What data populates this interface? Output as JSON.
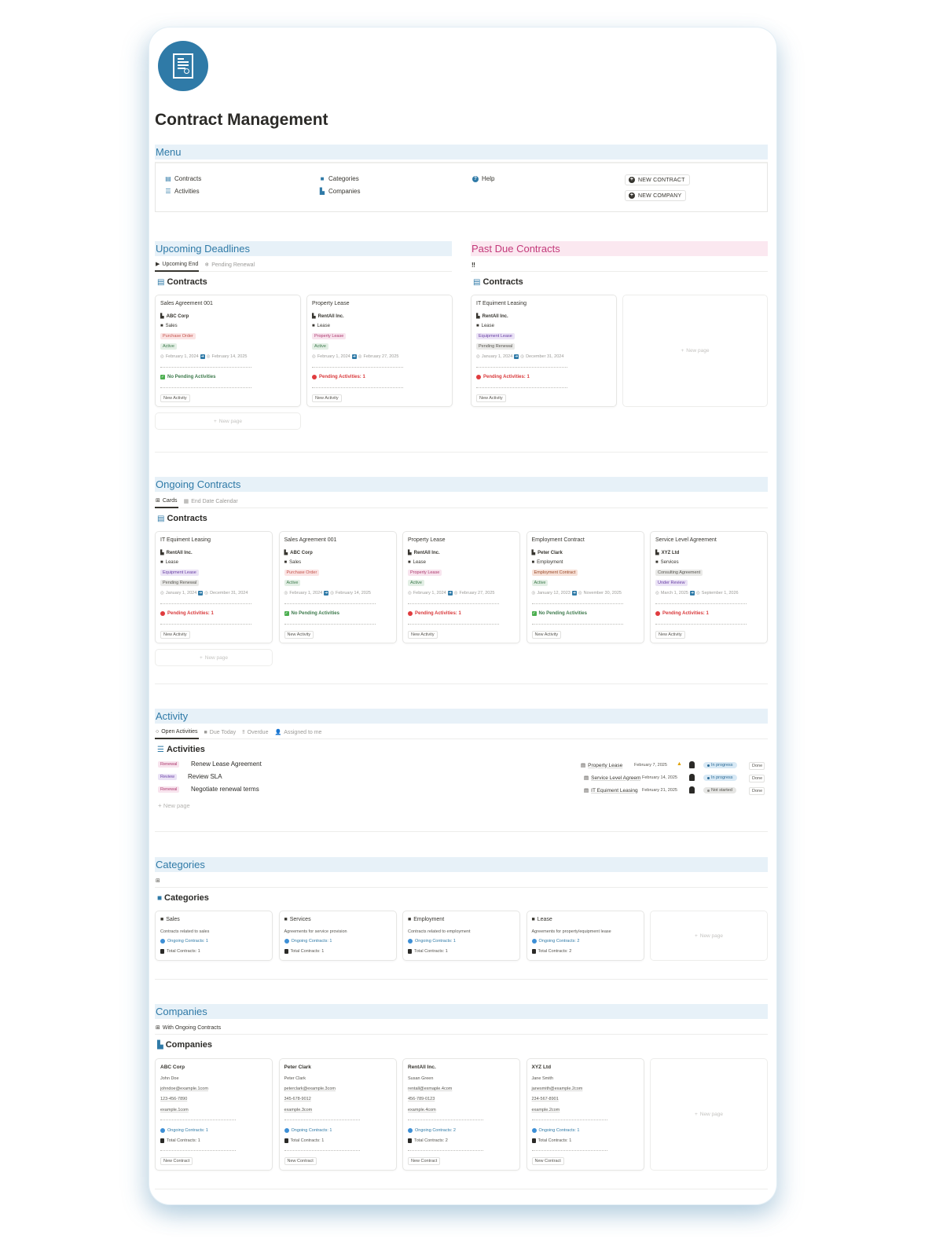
{
  "page": {
    "title": "Contract Management",
    "icon": "contract-certificate-icon"
  },
  "menu": {
    "header": "Menu",
    "links": [
      {
        "label": "Contracts",
        "icon": "contract-icon"
      },
      {
        "label": "Activities",
        "icon": "checklist-icon"
      },
      {
        "label": "Categories",
        "icon": "folder-icon"
      },
      {
        "label": "Companies",
        "icon": "buildings-icon"
      },
      {
        "label": "Help",
        "icon": "help-circle-icon"
      }
    ],
    "buttons": [
      {
        "label": "NEW CONTRACT",
        "icon": "plus-circle-icon"
      },
      {
        "label": "NEW COMPANY",
        "icon": "plus-circle-icon"
      }
    ]
  },
  "upcoming": {
    "header": "Upcoming Deadlines",
    "tabs": [
      {
        "label": "Upcoming End",
        "icon": "flag-icon",
        "active": true
      },
      {
        "label": "Pending Renewal",
        "icon": "snowflake-gear-icon",
        "active": false
      }
    ],
    "db_title": "Contracts",
    "cards": [
      {
        "name": "Sales Agreement 001",
        "company": "ABC Corp",
        "category": "Sales",
        "type": "Purchase Order",
        "status": "Active",
        "start": "February 1, 2024",
        "end": "February 14, 2025",
        "activities": "No Pending Activities",
        "button": "New Activity"
      },
      {
        "name": "Property Lease",
        "company": "RentAll Inc.",
        "category": "Lease",
        "type": "Property Lease",
        "status": "Active",
        "start": "February 1, 2024",
        "end": "February 27, 2025",
        "activities": "Pending Activities: 1",
        "button": "New Activity"
      }
    ],
    "new_page": "New page"
  },
  "past_due": {
    "header": "Past Due Contracts",
    "tab_icon": "double-exclamation-icon",
    "tab_label": "‼",
    "db_title": "Contracts",
    "cards": [
      {
        "name": "IT Equiment Leasing",
        "company": "RentAll Inc.",
        "category": "Lease",
        "type": "Equipment Lease",
        "status": "Pending Renewal",
        "start": "January 1, 2024",
        "end": "December 31, 2024",
        "activities": "Pending Activities: 1",
        "button": "New Activity"
      }
    ],
    "new_page": "New page"
  },
  "ongoing": {
    "header": "Ongoing Contracts",
    "tabs": [
      {
        "label": "Cards",
        "icon": "grid-icon",
        "active": true
      },
      {
        "label": "End Date Calendar",
        "icon": "calendar-icon",
        "active": false
      }
    ],
    "db_title": "Contracts",
    "cards": [
      {
        "name": "IT Equiment Leasing",
        "company": "RentAll Inc.",
        "category": "Lease",
        "type": "Equipment Lease",
        "status": "Pending Renewal",
        "start": "January 1, 2024",
        "end": "December 31, 2024",
        "activities": "Pending Activities: 1",
        "button": "New Activity"
      },
      {
        "name": "Sales Agreement 001",
        "company": "ABC Corp",
        "category": "Sales",
        "type": "Purchase Order",
        "status": "Active",
        "start": "February 1, 2024",
        "end": "February 14, 2025",
        "activities": "No Pending Activities",
        "button": "New Activity"
      },
      {
        "name": "Property Lease",
        "company": "RentAll Inc.",
        "category": "Lease",
        "type": "Property Lease",
        "status": "Active",
        "start": "February 1, 2024",
        "end": "February 27, 2025",
        "activities": "Pending Activities: 1",
        "button": "New Activity"
      },
      {
        "name": "Employment Contract",
        "company": "Peter Clark",
        "category": "Employment",
        "type": "Employment Contract",
        "status": "Active",
        "start": "January 12, 2023",
        "end": "November 30, 2025",
        "activities": "No Pending Activities",
        "button": "New Activity"
      },
      {
        "name": "Service Level Agreement",
        "company": "XYZ Ltd",
        "category": "Services",
        "type": "Consulting Agreement",
        "status": "Under Review",
        "start": "March 1, 2025",
        "end": "September 1, 2026",
        "activities": "Pending Activities: 1",
        "button": "New Activity"
      }
    ],
    "new_page": "New page"
  },
  "activity": {
    "header": "Activity",
    "tabs": [
      {
        "label": "Open Activities",
        "icon": "circle-icon",
        "active": true
      },
      {
        "label": "Due Today",
        "icon": "calendar-today-icon",
        "active": false
      },
      {
        "label": "Overdue",
        "icon": "double-exclamation-icon",
        "active": false
      },
      {
        "label": "Assigned to me",
        "icon": "person-check-icon",
        "active": false
      }
    ],
    "db_title": "Activities",
    "rows": [
      {
        "tag": "Renewal",
        "name": "Renew Lease Agreement",
        "contract": "Property Lease",
        "date": "February 7, 2025",
        "warning": true,
        "status": "In progress",
        "done": "Done"
      },
      {
        "tag": "Review",
        "name": "Review SLA",
        "contract": "Service Level Agreement",
        "date": "February 14, 2025",
        "warning": false,
        "status": "In progress",
        "done": "Done"
      },
      {
        "tag": "Renewal",
        "name": "Negotiate renewal terms",
        "contract": "IT Equiment Leasing",
        "date": "February 21, 2025",
        "warning": false,
        "status": "Not started",
        "done": "Done"
      }
    ],
    "new_page": "New page"
  },
  "categories": {
    "header": "Categories",
    "tab_icon": "grid-icon",
    "db_title": "Categories",
    "cards": [
      {
        "name": "Sales",
        "description": "Contracts related to sales",
        "ongoing": "Ongoing Contracts: 1",
        "total": "Total Contracts: 1"
      },
      {
        "name": "Services",
        "description": "Agreements for service provision",
        "ongoing": "Ongoing Contracts: 1",
        "total": "Total Contracts: 1"
      },
      {
        "name": "Employment",
        "description": "Contracts related to employment",
        "ongoing": "Ongoing Contracts: 1",
        "total": "Total Contracts: 1"
      },
      {
        "name": "Lease",
        "description": "Agreements for property/equipment lease",
        "ongoing": "Ongoing Contracts: 2",
        "total": "Total Contracts: 2"
      }
    ],
    "new_page": "New page"
  },
  "companies": {
    "header": "Companies",
    "tab_label": "With Ongoing Contracts",
    "tab_icon": "grid-icon",
    "db_title": "Companies",
    "cards": [
      {
        "name": "ABC Corp",
        "contact": "John Doe",
        "email": "johndoe@example.1com",
        "phone": "123-456-7890",
        "website": "example.1com",
        "ongoing": "Ongoing Contracts: 1",
        "total": "Total Contracts: 1",
        "button": "New Contract"
      },
      {
        "name": "Peter Clark",
        "contact": "Peter Clark",
        "email": "peterclark@example.3com",
        "phone": "345-678-9012",
        "website": "example.3com",
        "ongoing": "Ongoing Contracts: 1",
        "total": "Total Contracts: 1",
        "button": "New Contract"
      },
      {
        "name": "RentAll Inc.",
        "contact": "Susan Green",
        "email": "rentall@exmaple.4com",
        "phone": "456-789-0123",
        "website": "example.4com",
        "ongoing": "Ongoing Contracts: 2",
        "total": "Total Contracts: 2",
        "button": "New Contract"
      },
      {
        "name": "XYZ Ltd",
        "contact": "Jane Smith",
        "email": "janesmith@example.2com",
        "phone": "234-567-8901",
        "website": "example.2com",
        "ongoing": "Ongoing Contracts: 1",
        "total": "Total Contracts: 1",
        "button": "New Contract"
      }
    ],
    "new_page": "New page"
  },
  "colors": {
    "accent": "#2f7aa7",
    "section_bg": "#e7f1f8",
    "past_due_bg": "#fbe8f0",
    "past_due_text": "#c3397a",
    "pending_red": "#d9393b",
    "ok_green": "#3d7a4c"
  }
}
